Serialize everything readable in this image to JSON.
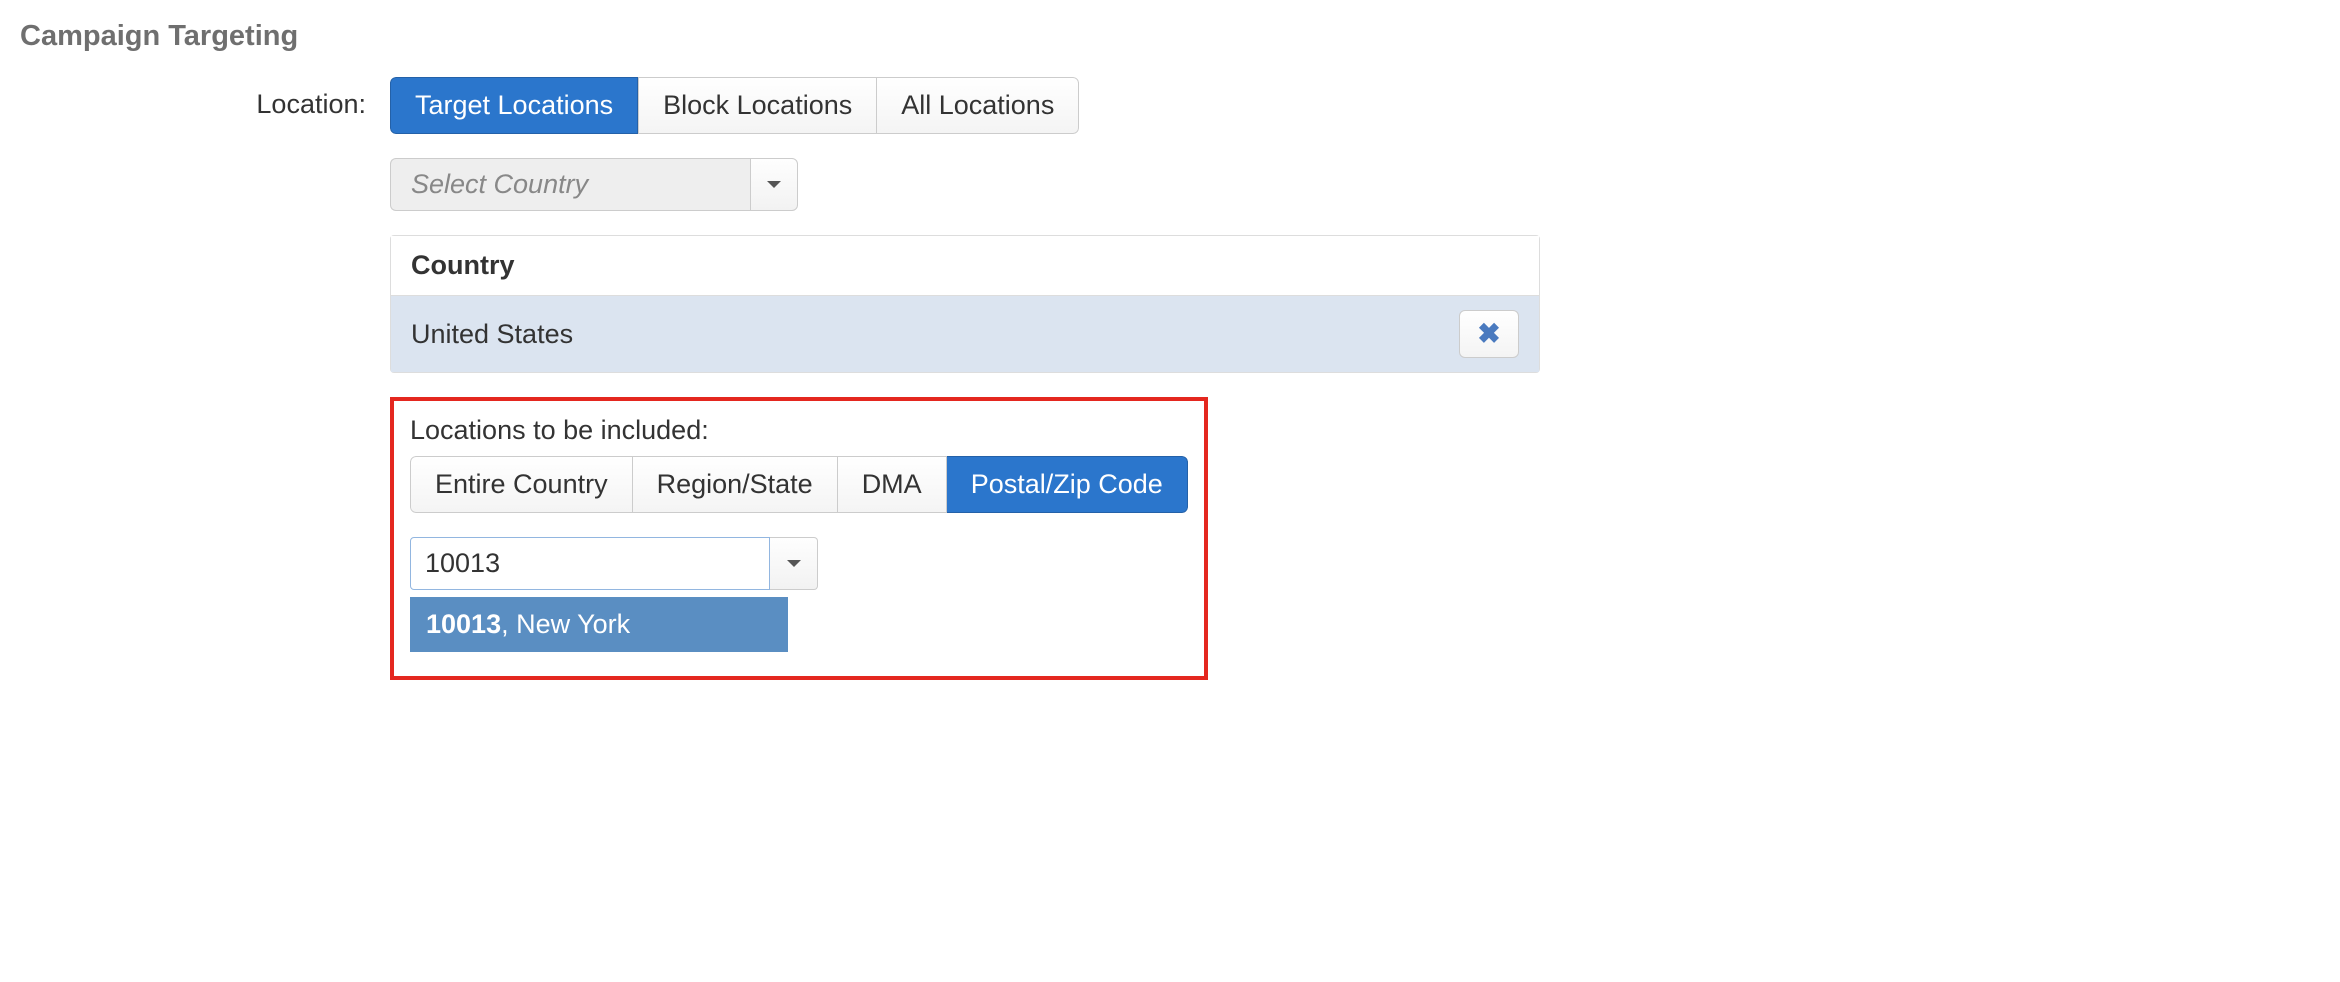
{
  "page_title": "Campaign Targeting",
  "location": {
    "label": "Location:",
    "mode_tabs": [
      {
        "label": "Target Locations",
        "active": true
      },
      {
        "label": "Block Locations",
        "active": false
      },
      {
        "label": "All Locations",
        "active": false
      }
    ],
    "country_select_placeholder": "Select Country",
    "country_panel": {
      "header": "Country",
      "rows": [
        {
          "name": "United States"
        }
      ]
    },
    "include": {
      "label": "Locations to be included:",
      "scope_tabs": [
        {
          "label": "Entire Country",
          "active": false
        },
        {
          "label": "Region/State",
          "active": false
        },
        {
          "label": "DMA",
          "active": false
        },
        {
          "label": "Postal/Zip Code",
          "active": true
        }
      ],
      "search_value": "10013",
      "suggestion": {
        "match": "10013",
        "rest": ", New York"
      }
    }
  }
}
